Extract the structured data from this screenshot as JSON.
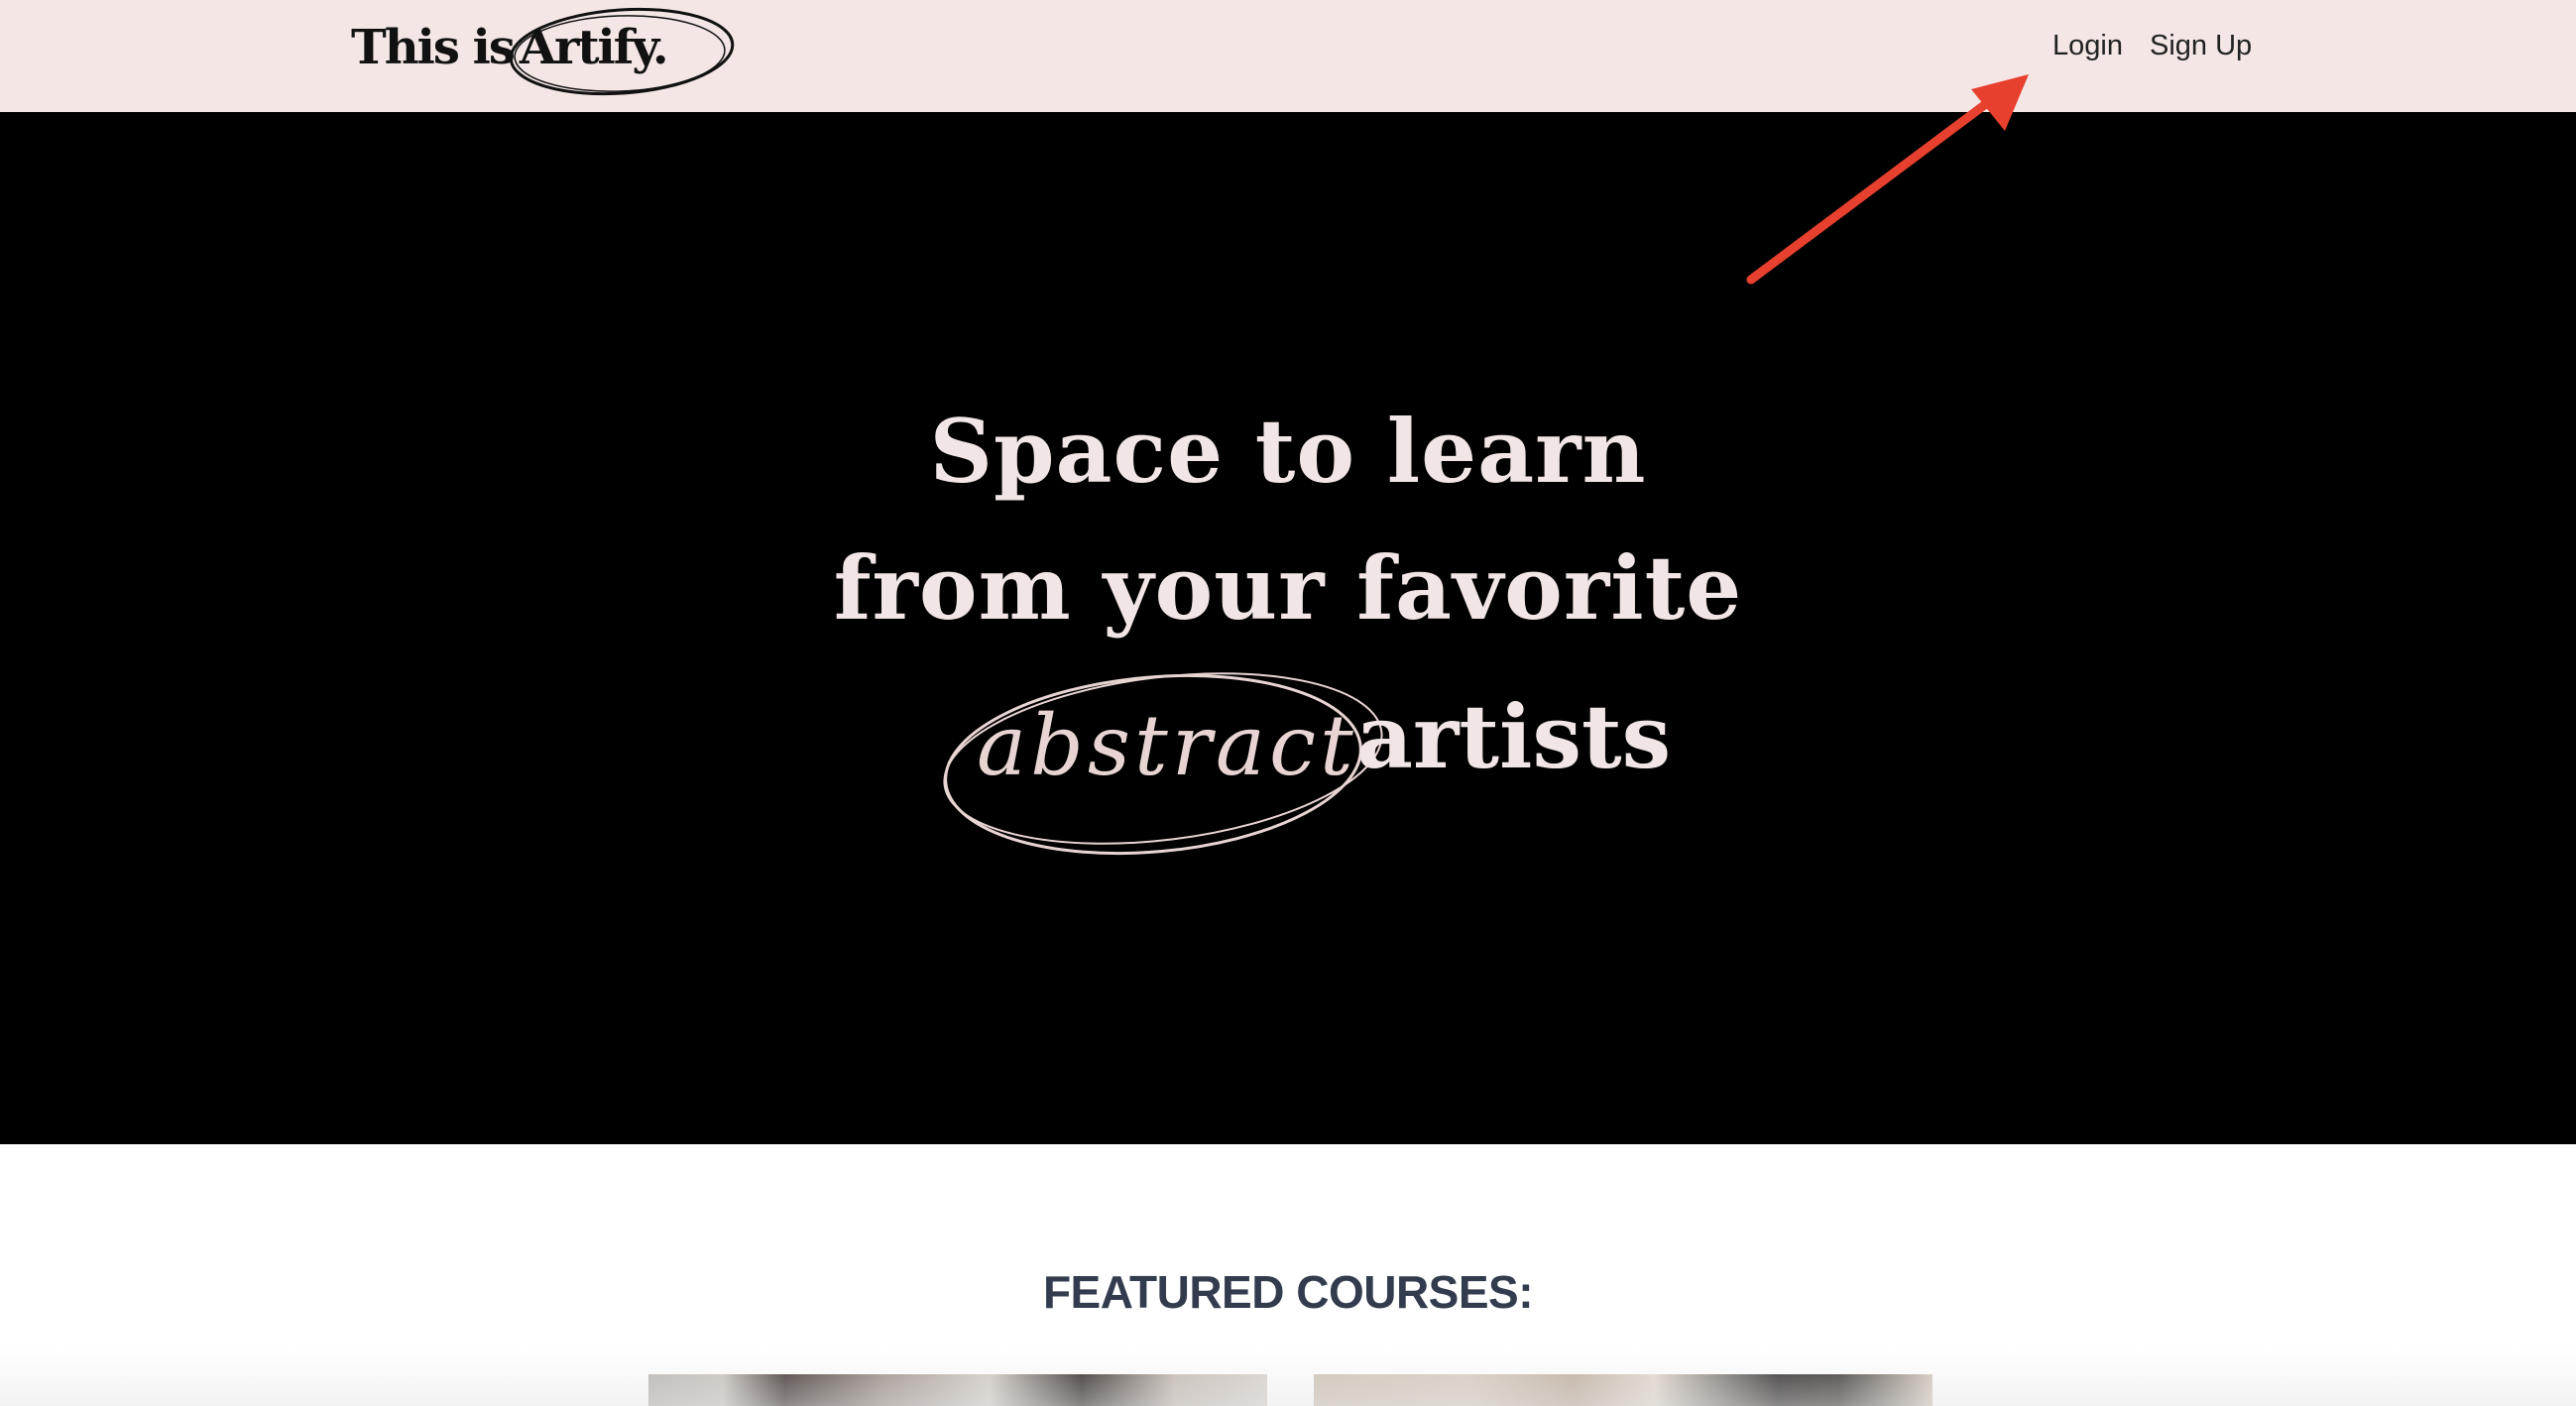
{
  "header": {
    "logo_part1": "This is",
    "logo_part2": "Artify.",
    "nav": {
      "login": "Login",
      "signup": "Sign Up"
    }
  },
  "hero": {
    "line1": "Space to learn",
    "line2": "from your favorite",
    "script_word": "abstract",
    "line3_end": "artists"
  },
  "featured": {
    "heading": "FEATURED COURSES:",
    "cards": [
      "course-image",
      "course-image"
    ]
  },
  "colors": {
    "header_bg": "#f3e6e5",
    "hero_bg": "#000000",
    "hero_text": "#f1e6e5",
    "heading_text": "#333c4e",
    "annotation": "#e8402e"
  },
  "icons": {
    "annotation": "red-arrow-icon"
  }
}
